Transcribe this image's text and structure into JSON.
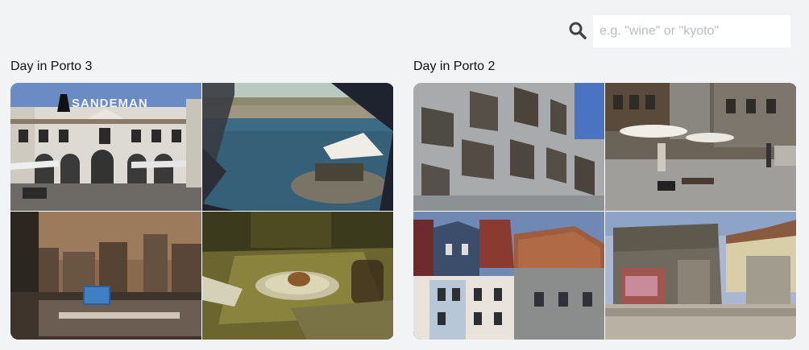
{
  "search": {
    "placeholder": "e.g. \"wine\" or \"kyoto\"",
    "icon": "search-icon"
  },
  "albums": [
    {
      "title": "Day in Porto 3",
      "photos": [
        {
          "sign_text": "SANDEMAN"
        },
        {},
        {},
        {}
      ]
    },
    {
      "title": "Day in Porto 2",
      "photos": [
        {},
        {},
        {},
        {}
      ]
    }
  ],
  "colors": {
    "background": "#f2f3f5",
    "input_background": "#ffffff",
    "placeholder": "#b8bcc2",
    "icon": "#444444"
  }
}
